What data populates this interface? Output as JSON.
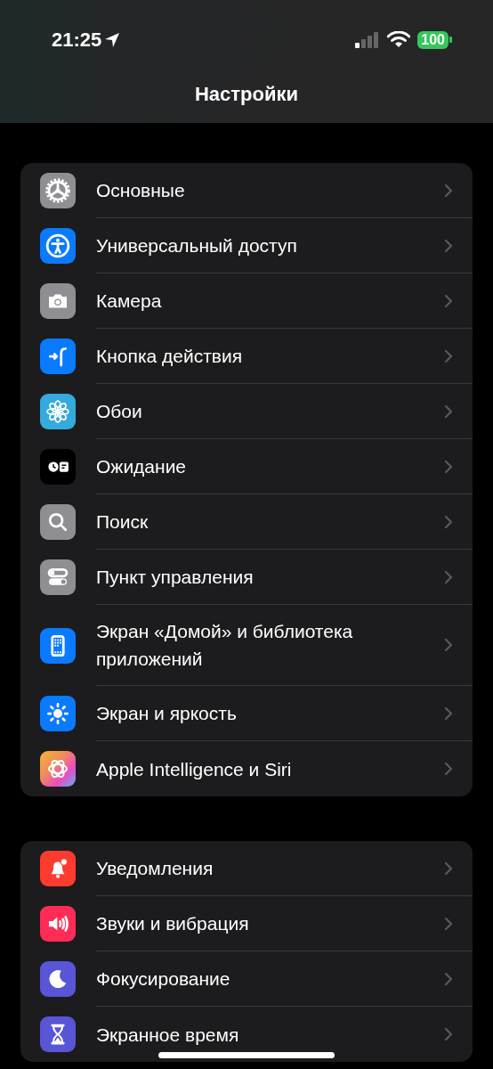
{
  "status_bar": {
    "time": "21:25",
    "battery": "100"
  },
  "title": "Настройки",
  "groups": [
    {
      "items": [
        {
          "label": "Основные",
          "kind": "gear",
          "color": "#8e8e93"
        },
        {
          "label": "Универсальный доступ",
          "kind": "accessibility",
          "color": "#0a7aff"
        },
        {
          "label": "Камера",
          "kind": "camera",
          "color": "#8e8e93"
        },
        {
          "label": "Кнопка действия",
          "kind": "action",
          "color": "#0a7aff"
        },
        {
          "label": "Обои",
          "kind": "flower",
          "color": "#35aadc"
        },
        {
          "label": "Ожидание",
          "kind": "standby",
          "color": "#000000"
        },
        {
          "label": "Поиск",
          "kind": "search",
          "color": "#8e8e93"
        },
        {
          "label": "Пункт управления",
          "kind": "toggles",
          "color": "#8e8e93"
        },
        {
          "label": "Экран «Домой» и библиотека приложений",
          "kind": "phone",
          "color": "#0a7aff"
        },
        {
          "label": "Экран и яркость",
          "kind": "sun",
          "color": "#0a7aff"
        },
        {
          "label": "Apple Intelligence и Siri",
          "kind": "intelligence"
        }
      ]
    },
    {
      "items": [
        {
          "label": "Уведомления",
          "kind": "bell",
          "color": "#ff3b30"
        },
        {
          "label": "Звуки и вибрация",
          "kind": "speaker",
          "color": "#ff2d55"
        },
        {
          "label": "Фокусирование",
          "kind": "moon",
          "color": "#5856d6"
        },
        {
          "label": "Экранное время",
          "kind": "hourglass",
          "color": "#5856d6"
        }
      ]
    }
  ]
}
